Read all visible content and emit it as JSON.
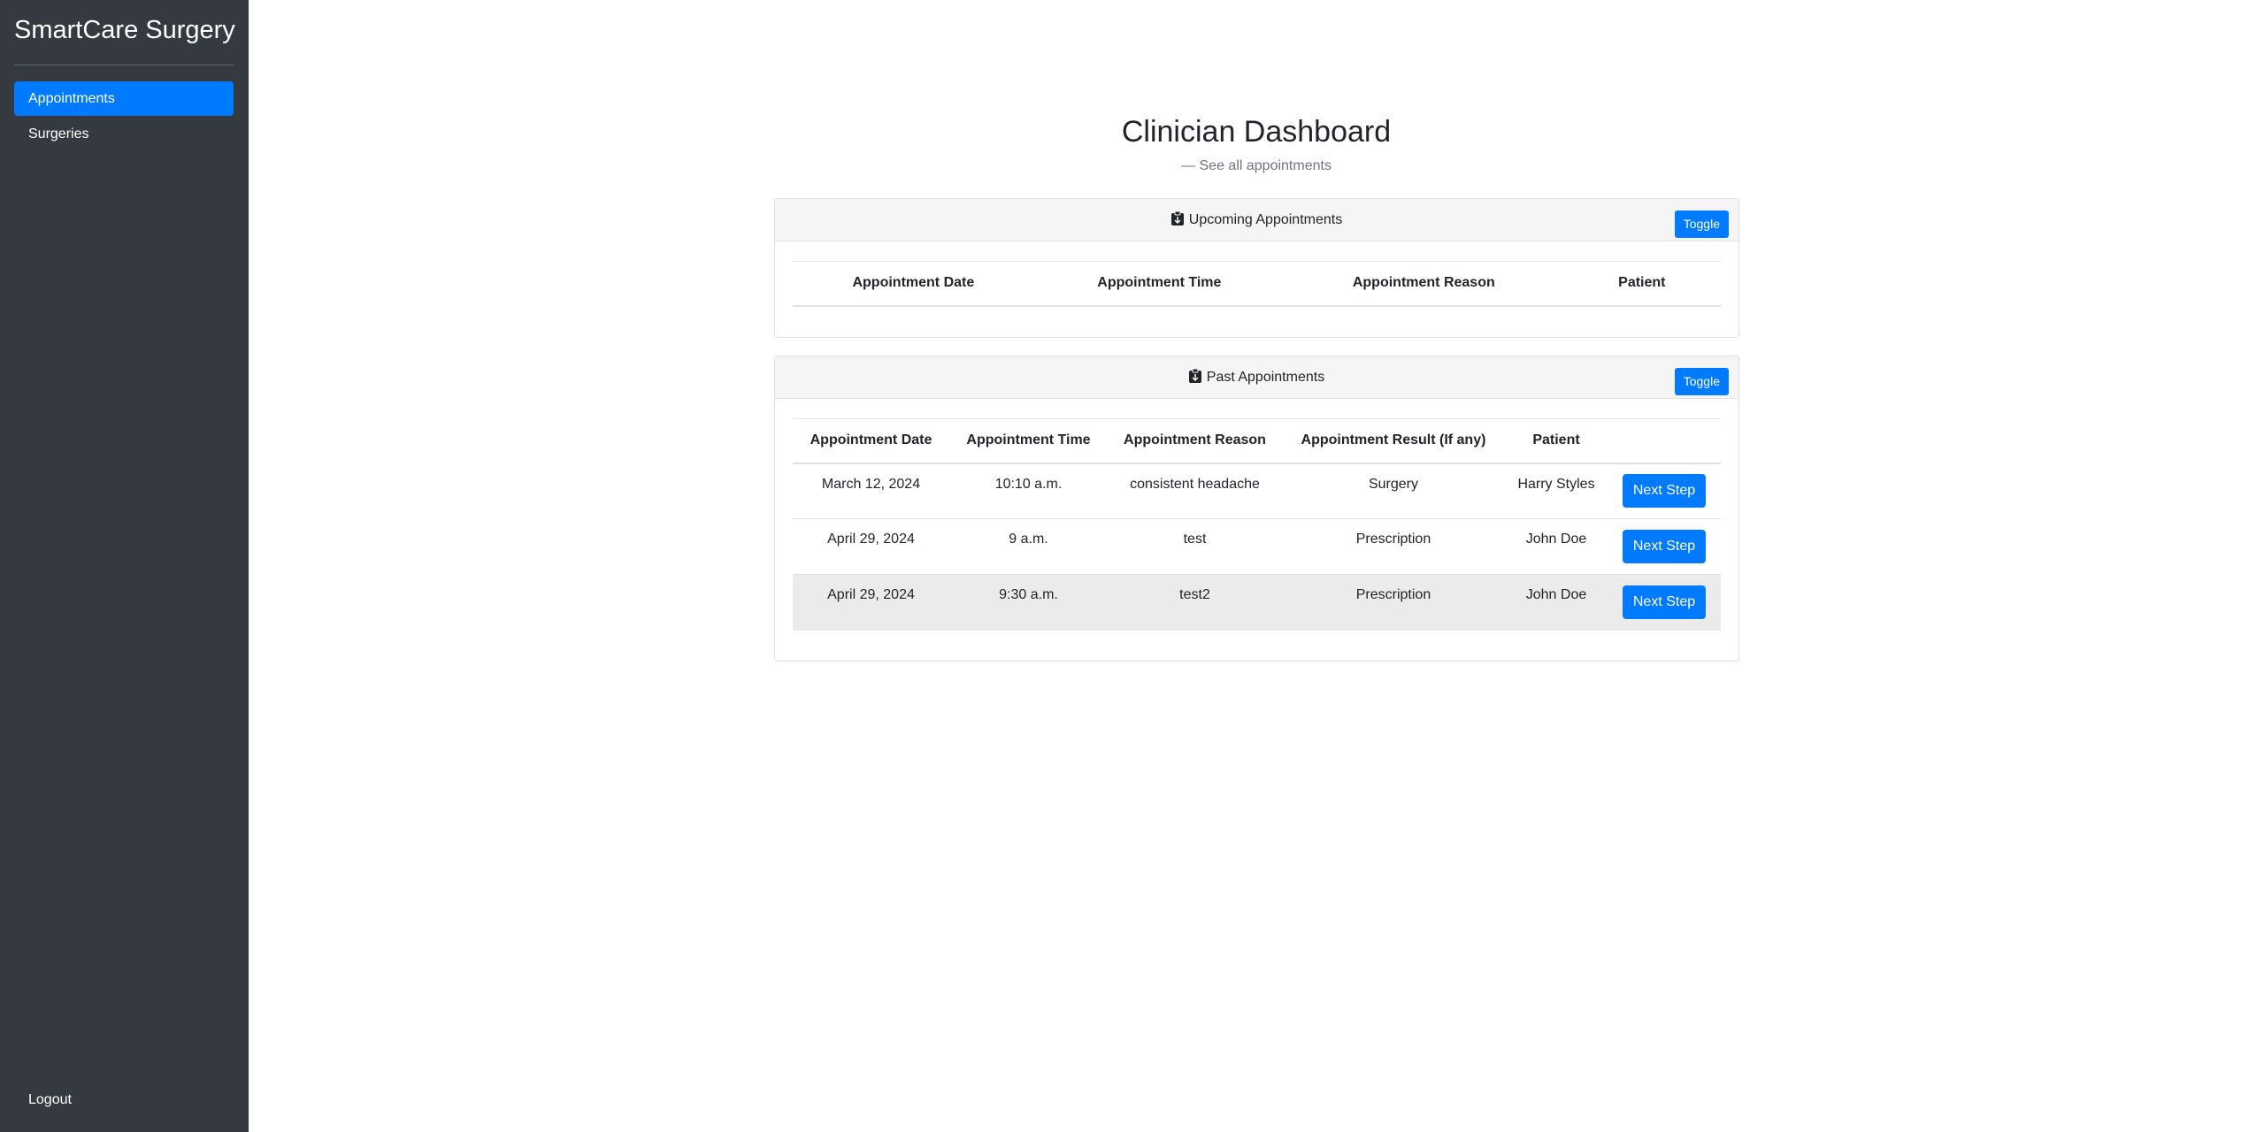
{
  "sidebar": {
    "brand": "SmartCare Surgery",
    "items": [
      {
        "label": "Appointments",
        "active": true
      },
      {
        "label": "Surgeries",
        "active": false
      }
    ],
    "logout": "Logout"
  },
  "main": {
    "title": "Clinician Dashboard",
    "subtitle": "— See all appointments"
  },
  "upcoming": {
    "title": "Upcoming Appointments",
    "toggle": "Toggle",
    "columns": [
      "Appointment Date",
      "Appointment Time",
      "Appointment Reason",
      "Patient"
    ],
    "rows": []
  },
  "past": {
    "title": "Past Appointments",
    "toggle": "Toggle",
    "columns": [
      "Appointment Date",
      "Appointment Time",
      "Appointment Reason",
      "Appointment Result (If any)",
      "Patient",
      ""
    ],
    "rows": [
      {
        "date": "March 12, 2024",
        "time": "10:10 a.m.",
        "reason": "consistent headache",
        "result": "Surgery",
        "patient": "Harry Styles",
        "action": "Next Step"
      },
      {
        "date": "April 29, 2024",
        "time": "9 a.m.",
        "reason": "test",
        "result": "Prescription",
        "patient": "John Doe",
        "action": "Next Step"
      },
      {
        "date": "April 29, 2024",
        "time": "9:30 a.m.",
        "reason": "test2",
        "result": "Prescription",
        "patient": "John Doe",
        "action": "Next Step"
      }
    ]
  },
  "colors": {
    "sidebar_bg": "#343a40",
    "accent": "#007bff",
    "header_bg": "#f5f5f5",
    "hover_row": "#ebebeb"
  },
  "icons": {
    "card_header_icon": "clipboard-icon"
  }
}
